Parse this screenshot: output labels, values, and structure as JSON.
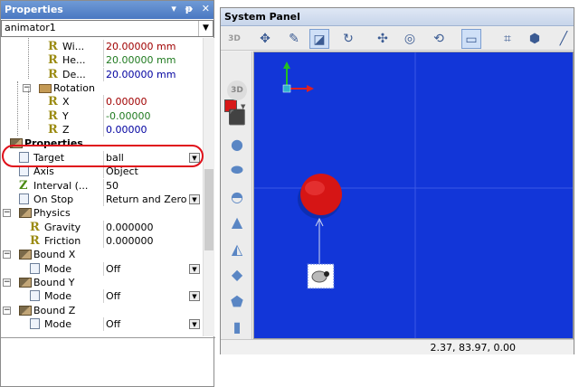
{
  "properties": {
    "title": "Properties",
    "title_icons": [
      "▾",
      "ᵽ",
      "✕"
    ],
    "object_selector": "animator1",
    "rows": [
      {
        "name": "Wi...",
        "value": "20.00000 mm",
        "color": "#a00000",
        "icon": "r-icon"
      },
      {
        "name": "He...",
        "value": "20.00000 mm",
        "color": "#1f7a1f",
        "icon": "r-icon"
      },
      {
        "name": "De...",
        "value": "20.00000 mm",
        "color": "#0000a0",
        "icon": "r-icon"
      },
      {
        "name": "Rotation",
        "value": "",
        "icon": "folder-icon"
      },
      {
        "name": "X",
        "value": "0.00000",
        "color": "#a00000",
        "icon": "r-icon"
      },
      {
        "name": "Y",
        "value": "-0.00000",
        "color": "#1f7a1f",
        "icon": "r-icon"
      },
      {
        "name": "Z",
        "value": "0.00000",
        "color": "#0000a0",
        "icon": "r-icon"
      },
      {
        "name": "Properties",
        "value": "",
        "icon": "properties-icon"
      },
      {
        "name": "Target",
        "value": "ball",
        "icon": "doc-icon",
        "dropdown": true
      },
      {
        "name": "Axis",
        "value": "Object",
        "icon": "doc-icon"
      },
      {
        "name": "Interval (...",
        "value": "50",
        "icon": "z-icon"
      },
      {
        "name": "On Stop",
        "value": "Return and Zero",
        "icon": "doc-icon",
        "dropdown": true
      },
      {
        "name": "Physics",
        "value": "",
        "icon": "group-icon"
      },
      {
        "name": "Gravity",
        "value": "0.000000",
        "icon": "r-icon"
      },
      {
        "name": "Friction",
        "value": "0.000000",
        "icon": "r-icon"
      },
      {
        "name": "Bound X",
        "value": "",
        "icon": "group-icon"
      },
      {
        "name": "Mode",
        "value": "Off",
        "icon": "doc-icon",
        "dropdown": true
      },
      {
        "name": "Bound Y",
        "value": "",
        "icon": "group-icon"
      },
      {
        "name": "Mode",
        "value": "Off",
        "icon": "doc-icon",
        "dropdown": true
      },
      {
        "name": "Bound Z",
        "value": "",
        "icon": "group-icon"
      },
      {
        "name": "Mode",
        "value": "Off",
        "icon": "doc-icon",
        "dropdown": true
      }
    ],
    "highlight_color": "#e0101a"
  },
  "system_panel": {
    "title": "System Panel",
    "toolbar_3d_label": "3D",
    "toolbar_icons": [
      "move-icon",
      "pen-icon",
      "select-icon",
      "rotate-icon",
      "pan-icon",
      "orbit-icon",
      "camera-icon",
      "frame-icon",
      "axes-icon",
      "cube-icon",
      "line-icon"
    ],
    "toolbar_active": [
      "select-icon",
      "frame-icon"
    ],
    "sidebar_3d_label": "3D",
    "sidebar_shapes": [
      "cube-icon",
      "sphere-icon",
      "ellipsoid-icon",
      "hemisphere-icon",
      "cone-icon",
      "pyramid-icon",
      "octahedron-icon",
      "prism-icon",
      "cylinder-icon"
    ],
    "color_swatch": "#d71818",
    "viewport_color": "#1236d8",
    "status_coords": "2.37, 83.97, 0.00"
  }
}
